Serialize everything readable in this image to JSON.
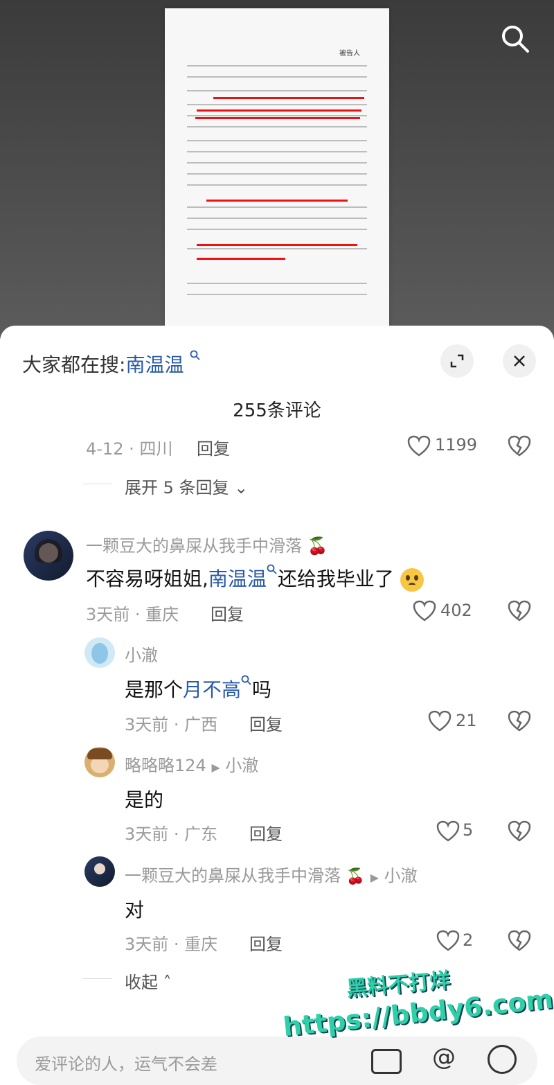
{
  "hot_search": {
    "prefix": "大家都在搜:",
    "keyword": "南温温"
  },
  "comments_title": "255条评论",
  "top_meta": {
    "date_loc": "4-12 · 四川",
    "reply": "回复",
    "likes": "1199"
  },
  "expand": "展开 5 条回复",
  "comment": {
    "name": "一颗豆大的鼻屎从我手中滑落",
    "text_a": "不容易呀姐姐,",
    "link": "南温温",
    "text_b": "还给我毕业了",
    "date_loc": "3天前 · 重庆",
    "reply": "回复",
    "likes": "402"
  },
  "replies": [
    {
      "name": "小澈",
      "text_a": "是那个",
      "link": "月不高",
      "text_b": "吗",
      "date_loc": "3天前 · 广西",
      "reply": "回复",
      "likes": "21"
    },
    {
      "name": "略略略124",
      "reply_to": "小澈",
      "text": "是的",
      "date_loc": "3天前 · 广东",
      "reply": "回复",
      "likes": "5"
    },
    {
      "name": "一颗豆大的鼻屎从我手中滑落",
      "reply_to": "小澈",
      "text": "对",
      "date_loc": "3天前 · 重庆",
      "reply": "回复",
      "likes": "2"
    }
  ],
  "collapse": "收起",
  "input_placeholder": "爱评论的人，运气不会差",
  "watermark": {
    "line1": "黑料不打烊",
    "line2": "https://bbdy6.com"
  }
}
